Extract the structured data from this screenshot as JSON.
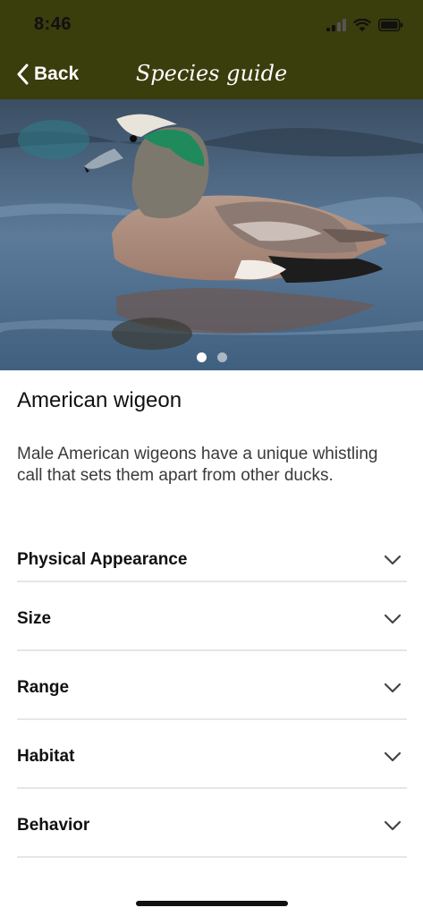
{
  "status_bar": {
    "time": "8:46"
  },
  "nav": {
    "back_label": "Back",
    "title": "Species guide"
  },
  "hero": {
    "image_subject": "duck-photo",
    "dots": [
      {
        "active": true
      },
      {
        "active": false
      }
    ]
  },
  "species": {
    "name": "American wigeon",
    "description": "Male American wigeons have a unique whistling call that sets them apart from other ducks."
  },
  "sections": [
    {
      "label": "Physical Appearance"
    },
    {
      "label": "Size"
    },
    {
      "label": "Range"
    },
    {
      "label": "Habitat"
    },
    {
      "label": "Behavior"
    }
  ],
  "colors": {
    "header": "#3a3d0c",
    "divider": "#e6e6e6"
  }
}
